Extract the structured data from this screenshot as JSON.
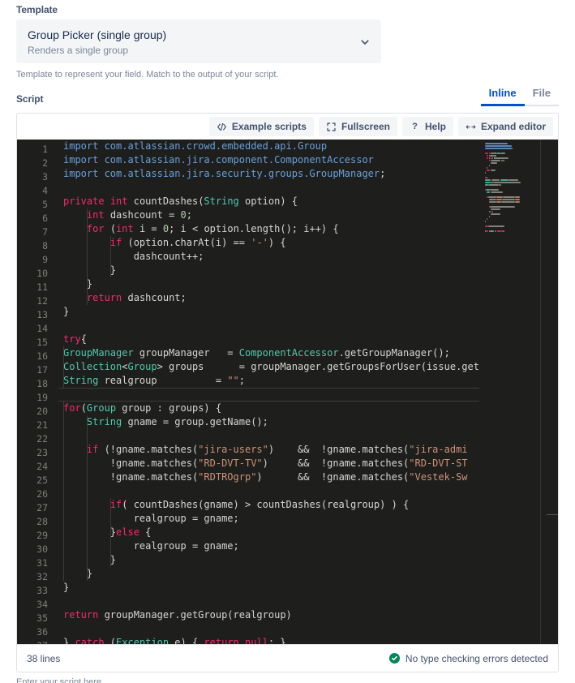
{
  "template_section": {
    "label": "Template",
    "selected": {
      "title": "Group Picker (single group)",
      "subtitle": "Renders a single group"
    },
    "help_text": "Template to represent your field. Match to the output of your script.",
    "chevron_icon": "chevron-down-icon"
  },
  "script_section": {
    "label": "Script",
    "tabs": [
      {
        "label": "Inline",
        "active": true
      },
      {
        "label": "File",
        "active": false
      }
    ]
  },
  "toolbar": {
    "buttons": [
      {
        "label": "Example scripts",
        "icon": "code-brackets-icon"
      },
      {
        "label": "Fullscreen",
        "icon": "fullscreen-icon"
      },
      {
        "label": "Help",
        "icon": "question-mark-icon"
      },
      {
        "label": "Expand editor",
        "icon": "expand-horizontal-icon"
      }
    ]
  },
  "editor": {
    "active_line": 19,
    "first_visible_line": 1,
    "lines": [
      {
        "n": 1,
        "tokens": [
          {
            "t": "import com.atlassian.crowd.embedded.api.Group",
            "c": "imp"
          }
        ]
      },
      {
        "n": 2,
        "tokens": [
          {
            "t": "import com.atlassian.jira.component.ComponentAccessor",
            "c": "imp"
          }
        ]
      },
      {
        "n": 3,
        "tokens": [
          {
            "t": "import com.atlassian.jira.security.groups.GroupManager",
            "c": "imp"
          },
          {
            "t": ";",
            "c": "op"
          }
        ]
      },
      {
        "n": 4,
        "tokens": []
      },
      {
        "n": 5,
        "tokens": [
          {
            "t": "private",
            "c": "kw"
          },
          {
            "t": " ",
            "c": "pl"
          },
          {
            "t": "int",
            "c": "kw"
          },
          {
            "t": " countDashes(",
            "c": "pl"
          },
          {
            "t": "String",
            "c": "typ"
          },
          {
            "t": " option) {",
            "c": "pl"
          }
        ]
      },
      {
        "n": 6,
        "tokens": [
          {
            "t": "    ",
            "c": "pl"
          },
          {
            "t": "int",
            "c": "kw"
          },
          {
            "t": " dashcount = ",
            "c": "pl"
          },
          {
            "t": "0",
            "c": "num"
          },
          {
            "t": ";",
            "c": "pl"
          }
        ]
      },
      {
        "n": 7,
        "tokens": [
          {
            "t": "    ",
            "c": "pl"
          },
          {
            "t": "for",
            "c": "kw"
          },
          {
            "t": " (",
            "c": "pl"
          },
          {
            "t": "int",
            "c": "kw"
          },
          {
            "t": " i = ",
            "c": "pl"
          },
          {
            "t": "0",
            "c": "num"
          },
          {
            "t": "; i < option.length(); i++) {",
            "c": "pl"
          }
        ]
      },
      {
        "n": 8,
        "tokens": [
          {
            "t": "        ",
            "c": "pl"
          },
          {
            "t": "if",
            "c": "kw"
          },
          {
            "t": " (option.charAt(i) == ",
            "c": "pl"
          },
          {
            "t": "'-'",
            "c": "str"
          },
          {
            "t": ") {",
            "c": "pl"
          }
        ]
      },
      {
        "n": 9,
        "tokens": [
          {
            "t": "            dashcount++;",
            "c": "pl"
          }
        ]
      },
      {
        "n": 10,
        "tokens": [
          {
            "t": "        }",
            "c": "pl"
          }
        ]
      },
      {
        "n": 11,
        "tokens": [
          {
            "t": "    }",
            "c": "pl"
          }
        ]
      },
      {
        "n": 12,
        "tokens": [
          {
            "t": "    ",
            "c": "pl"
          },
          {
            "t": "return",
            "c": "kw"
          },
          {
            "t": " dashcount;",
            "c": "pl"
          }
        ]
      },
      {
        "n": 13,
        "tokens": [
          {
            "t": "}",
            "c": "pl"
          }
        ]
      },
      {
        "n": 14,
        "tokens": []
      },
      {
        "n": 15,
        "tokens": [
          {
            "t": "try",
            "c": "kw"
          },
          {
            "t": "{",
            "c": "pl"
          }
        ]
      },
      {
        "n": 16,
        "tokens": [
          {
            "t": "GroupManager",
            "c": "typ"
          },
          {
            "t": " groupManager   = ",
            "c": "pl"
          },
          {
            "t": "ComponentAccessor",
            "c": "typ"
          },
          {
            "t": ".getGroupManager();",
            "c": "pl"
          }
        ]
      },
      {
        "n": 17,
        "tokens": [
          {
            "t": "Collection",
            "c": "typ"
          },
          {
            "t": "<",
            "c": "pl"
          },
          {
            "t": "Group",
            "c": "typ"
          },
          {
            "t": "> groups      = groupManager.getGroupsForUser(issue.get",
            "c": "pl"
          }
        ]
      },
      {
        "n": 18,
        "tokens": [
          {
            "t": "String",
            "c": "typ"
          },
          {
            "t": " realgroup          = ",
            "c": "pl"
          },
          {
            "t": "\"\"",
            "c": "str"
          },
          {
            "t": ";",
            "c": "pl"
          }
        ]
      },
      {
        "n": 19,
        "tokens": []
      },
      {
        "n": 20,
        "tokens": [
          {
            "t": "for",
            "c": "kw"
          },
          {
            "t": "(",
            "c": "pl"
          },
          {
            "t": "Group",
            "c": "typ"
          },
          {
            "t": " group : groups) {",
            "c": "pl"
          }
        ]
      },
      {
        "n": 21,
        "tokens": [
          {
            "t": "    ",
            "c": "pl"
          },
          {
            "t": "String",
            "c": "typ"
          },
          {
            "t": " gname = group.getName();",
            "c": "pl"
          }
        ]
      },
      {
        "n": 22,
        "tokens": []
      },
      {
        "n": 23,
        "tokens": [
          {
            "t": "    ",
            "c": "pl"
          },
          {
            "t": "if",
            "c": "kw"
          },
          {
            "t": " (!gname.matches(",
            "c": "pl"
          },
          {
            "t": "\"jira-users\"",
            "c": "str"
          },
          {
            "t": ")    &&  !gname.matches(",
            "c": "pl"
          },
          {
            "t": "\"jira-admi",
            "c": "str"
          }
        ]
      },
      {
        "n": 24,
        "tokens": [
          {
            "t": "        !gname.matches(",
            "c": "pl"
          },
          {
            "t": "\"RD-DVT-TV\"",
            "c": "str"
          },
          {
            "t": ")     &&  !gname.matches(",
            "c": "pl"
          },
          {
            "t": "\"RD-DVT-ST",
            "c": "str"
          }
        ]
      },
      {
        "n": 25,
        "tokens": [
          {
            "t": "        !gname.matches(",
            "c": "pl"
          },
          {
            "t": "\"RDTROgrp\"",
            "c": "str"
          },
          {
            "t": ")      &&  !gname.matches(",
            "c": "pl"
          },
          {
            "t": "\"Vestek-Sw",
            "c": "str"
          }
        ]
      },
      {
        "n": 26,
        "tokens": []
      },
      {
        "n": 27,
        "tokens": [
          {
            "t": "        ",
            "c": "pl"
          },
          {
            "t": "if",
            "c": "kw"
          },
          {
            "t": "( countDashes(gname) > countDashes(realgroup) ) {",
            "c": "pl"
          }
        ]
      },
      {
        "n": 28,
        "tokens": [
          {
            "t": "            realgroup = gname;",
            "c": "pl"
          }
        ]
      },
      {
        "n": 29,
        "tokens": [
          {
            "t": "        }",
            "c": "pl"
          },
          {
            "t": "else",
            "c": "kw"
          },
          {
            "t": " {",
            "c": "pl"
          }
        ]
      },
      {
        "n": 30,
        "tokens": [
          {
            "t": "            realgroup = gname;",
            "c": "pl"
          }
        ]
      },
      {
        "n": 31,
        "tokens": [
          {
            "t": "        }",
            "c": "pl"
          }
        ]
      },
      {
        "n": 32,
        "tokens": [
          {
            "t": "    }",
            "c": "pl"
          }
        ]
      },
      {
        "n": 33,
        "tokens": [
          {
            "t": "}",
            "c": "pl"
          }
        ]
      },
      {
        "n": 34,
        "tokens": []
      },
      {
        "n": 35,
        "tokens": [
          {
            "t": "return",
            "c": "kw"
          },
          {
            "t": " groupManager.getGroup(realgroup)",
            "c": "pl"
          }
        ]
      },
      {
        "n": 36,
        "tokens": []
      },
      {
        "n": 37,
        "tokens": [
          {
            "t": "} ",
            "c": "pl"
          },
          {
            "t": "catch",
            "c": "kw"
          },
          {
            "t": " (",
            "c": "pl"
          },
          {
            "t": "Exception",
            "c": "typ"
          },
          {
            "t": " e) { ",
            "c": "pl"
          },
          {
            "t": "return",
            "c": "kw"
          },
          {
            "t": " ",
            "c": "pl"
          },
          {
            "t": "null",
            "c": "kw"
          },
          {
            "t": "; }",
            "c": "pl"
          }
        ]
      }
    ]
  },
  "statusbar": {
    "lines_label": "38 lines",
    "status_message": "No type checking errors detected",
    "status_icon": "check-circle-icon",
    "status_color": "#00875a"
  },
  "bottom_hint": "Enter your script here"
}
